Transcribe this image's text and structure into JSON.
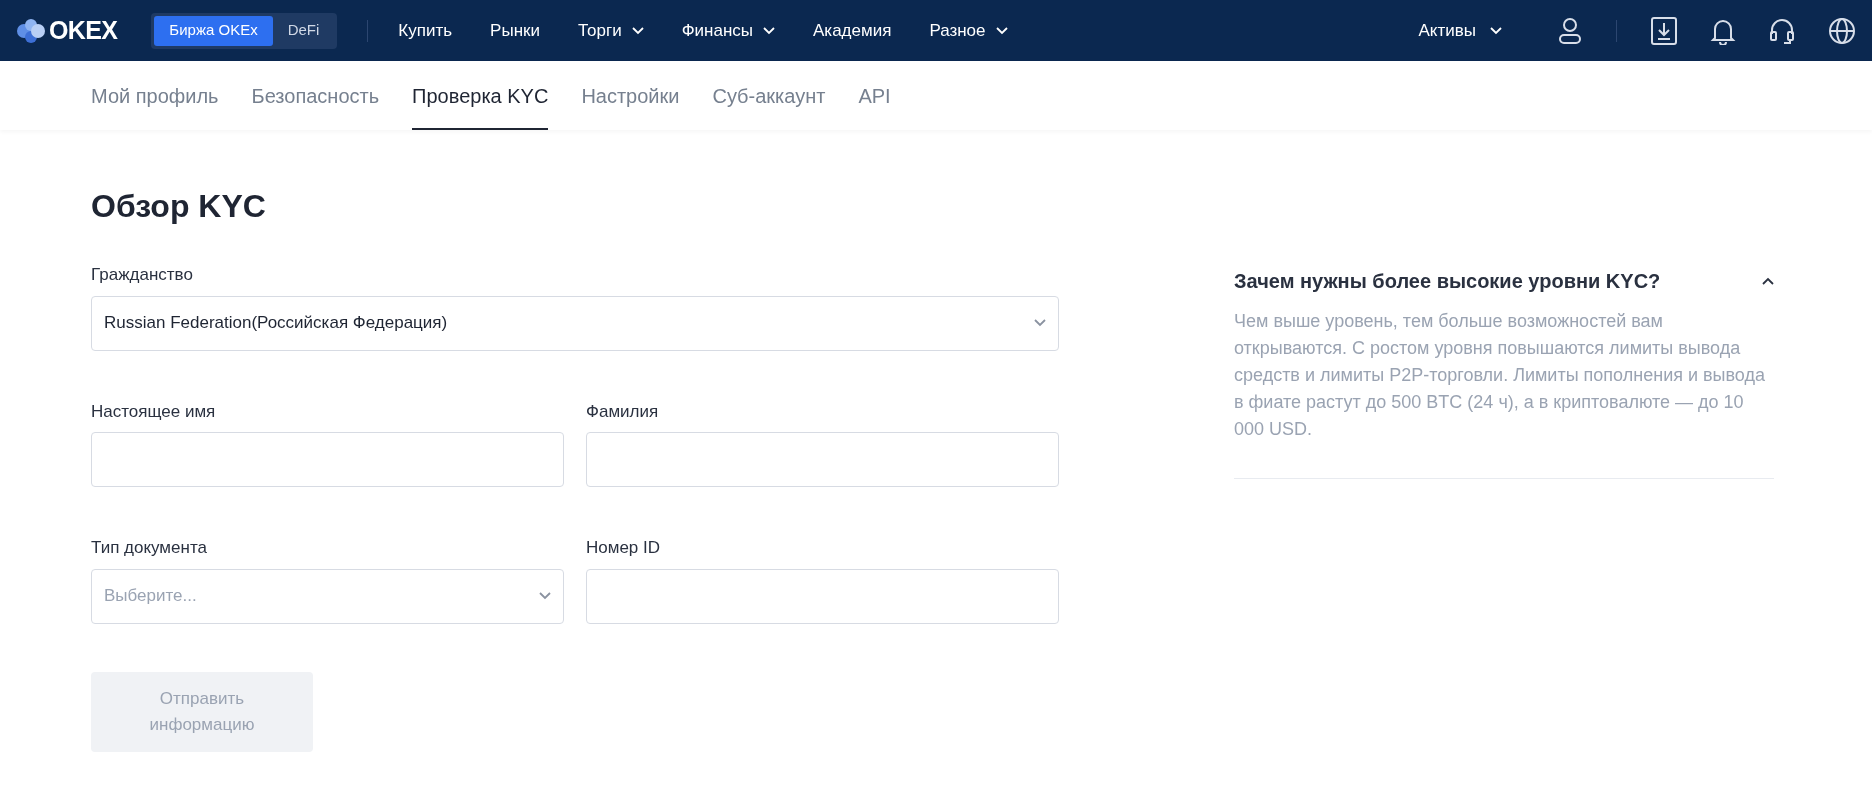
{
  "header": {
    "logo": "OKEX",
    "switch": [
      {
        "label": "Биржа OKEx",
        "selected": true
      },
      {
        "label": "DeFi",
        "selected": false
      }
    ],
    "nav": [
      {
        "label": "Купить",
        "dropdown": false
      },
      {
        "label": "Рынки",
        "dropdown": false
      },
      {
        "label": "Торги",
        "dropdown": true
      },
      {
        "label": "Финансы",
        "dropdown": true
      },
      {
        "label": "Академия",
        "dropdown": false
      },
      {
        "label": "Разное",
        "dropdown": true
      }
    ],
    "assets": {
      "label": "Активы",
      "dropdown": true
    }
  },
  "tabs": [
    {
      "label": "Мой профиль",
      "selected": false
    },
    {
      "label": "Безопасность",
      "selected": false
    },
    {
      "label": "Проверка KYC",
      "selected": true
    },
    {
      "label": "Настройки",
      "selected": false
    },
    {
      "label": "Суб-аккаунт",
      "selected": false
    },
    {
      "label": "API",
      "selected": false
    }
  ],
  "title": "Обзор KYC",
  "form": {
    "rows": [
      [
        {
          "kind": "select",
          "label": "Гражданство",
          "value": "Russian Federation(Российская Федерация)"
        }
      ],
      [
        {
          "kind": "input",
          "label": "Настоящее имя"
        },
        {
          "kind": "input",
          "label": "Фамилия"
        }
      ],
      [
        {
          "kind": "select",
          "label": "Тип документа",
          "placeholder": "Выберите..."
        },
        {
          "kind": "input",
          "label": "Номер ID"
        }
      ]
    ],
    "submit": {
      "label": "Отправить информацию",
      "disabled": true
    }
  },
  "faq": {
    "question": "Зачем нужны более высокие уровни KYC?",
    "expanded": true,
    "answer": "Чем выше уровень, тем больше возможностей вам открываются. С ростом уровня повышаются лимиты вывода средств и лимиты P2P-торговли. Лимиты пополнения и вывода в фиате растут до 500 BTC (24 ч), а в криптовалюте — до 10 000 USD."
  }
}
